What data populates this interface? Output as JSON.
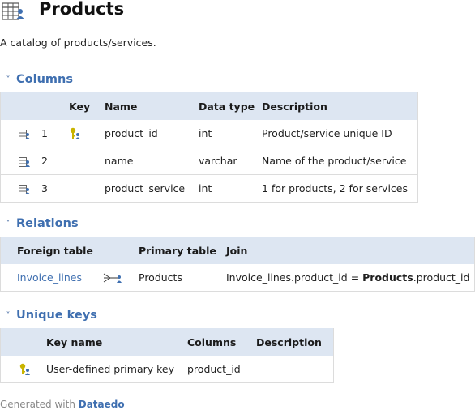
{
  "header": {
    "title": "Products",
    "description": "A catalog of products/services."
  },
  "columns_section": {
    "title": "Columns",
    "headers": {
      "key": "Key",
      "name": "Name",
      "data_type": "Data type",
      "description": "Description"
    },
    "rows": [
      {
        "num": "1",
        "name": "product_id",
        "data_type": "int",
        "description": "Product/service unique ID",
        "is_key": true
      },
      {
        "num": "2",
        "name": "name",
        "data_type": "varchar",
        "description": "Name of the product/service",
        "is_key": false
      },
      {
        "num": "3",
        "name": "product_service",
        "data_type": "int",
        "description": "1 for products, 2 for services",
        "is_key": false
      }
    ]
  },
  "relations_section": {
    "title": "Relations",
    "headers": {
      "foreign_table": "Foreign table",
      "primary_table": "Primary table",
      "join": "Join"
    },
    "rows": [
      {
        "foreign_table": "Invoice_lines",
        "primary_table": "Products",
        "join_prefix": "Invoice_lines.product_id = ",
        "join_bold": "Products",
        "join_suffix": ".product_id"
      }
    ]
  },
  "unique_keys_section": {
    "title": "Unique keys",
    "headers": {
      "key_name": "Key name",
      "columns": "Columns",
      "description": "Description"
    },
    "rows": [
      {
        "key_name": "User-defined primary key",
        "columns": "product_id",
        "description": ""
      }
    ]
  },
  "footer": {
    "prefix": "Generated with ",
    "brand": "Dataedo"
  },
  "colors": {
    "accent": "#3f6fb0",
    "header_bg": "#dde6f2",
    "key_yellow": "#c9b400"
  }
}
